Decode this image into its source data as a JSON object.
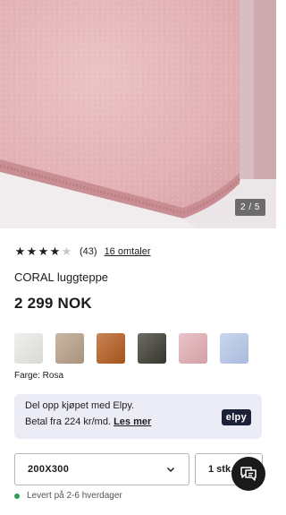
{
  "gallery": {
    "counter": "2 / 5",
    "rug_color": "#e8bcbe"
  },
  "rating": {
    "stars_filled": 4,
    "stars_total": 5,
    "count": "(43)",
    "reviews_label": "16 omtaler"
  },
  "product": {
    "name": "CORAL luggteppe",
    "price": "2 299 NOK"
  },
  "swatches": [
    {
      "name": "white",
      "color": "#ecebe7"
    },
    {
      "name": "beige",
      "color": "#b79f86"
    },
    {
      "name": "rust",
      "color": "#b45a1c"
    },
    {
      "name": "dark-olive",
      "color": "#3b3a31"
    },
    {
      "name": "rosa",
      "color": "#e3aeb4"
    },
    {
      "name": "light-blue",
      "color": "#b8c9ec"
    }
  ],
  "color_label": "Farge: Rosa",
  "elpy": {
    "line1": "Del opp kjøpet med Elpy.",
    "line2_prefix": "Betal fra 224 kr/md.",
    "link": "Les mer",
    "logo": "elpy"
  },
  "size_select": {
    "value": "200X300",
    "icon": "chevron-down-icon"
  },
  "quantity_select": {
    "value": "1 stk."
  },
  "chat": {
    "icon": "chat-icon"
  },
  "delivery": {
    "text": "Levert på 2-6 hverdager",
    "status_color": "#2e9d4f"
  }
}
